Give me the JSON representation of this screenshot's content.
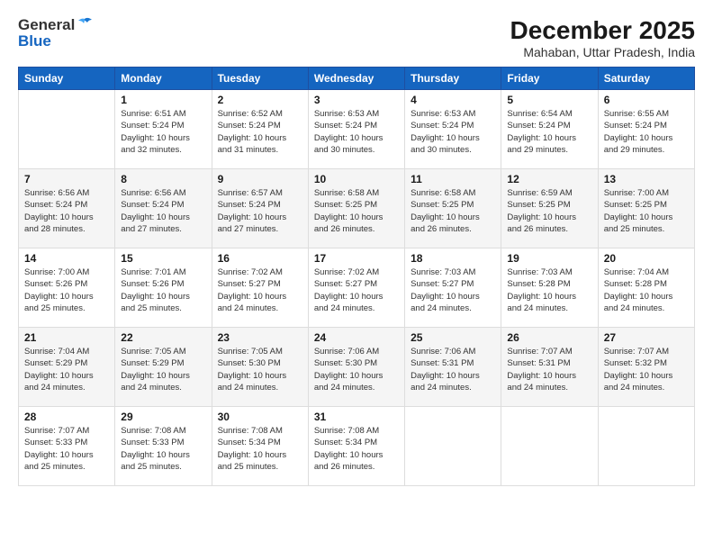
{
  "header": {
    "logo_general": "General",
    "logo_blue": "Blue",
    "title": "December 2025",
    "subtitle": "Mahaban, Uttar Pradesh, India"
  },
  "days_of_week": [
    "Sunday",
    "Monday",
    "Tuesday",
    "Wednesday",
    "Thursday",
    "Friday",
    "Saturday"
  ],
  "weeks": [
    {
      "gray": false,
      "cells": [
        {
          "day": "",
          "info": ""
        },
        {
          "day": "1",
          "info": "Sunrise: 6:51 AM\nSunset: 5:24 PM\nDaylight: 10 hours\nand 32 minutes."
        },
        {
          "day": "2",
          "info": "Sunrise: 6:52 AM\nSunset: 5:24 PM\nDaylight: 10 hours\nand 31 minutes."
        },
        {
          "day": "3",
          "info": "Sunrise: 6:53 AM\nSunset: 5:24 PM\nDaylight: 10 hours\nand 30 minutes."
        },
        {
          "day": "4",
          "info": "Sunrise: 6:53 AM\nSunset: 5:24 PM\nDaylight: 10 hours\nand 30 minutes."
        },
        {
          "day": "5",
          "info": "Sunrise: 6:54 AM\nSunset: 5:24 PM\nDaylight: 10 hours\nand 29 minutes."
        },
        {
          "day": "6",
          "info": "Sunrise: 6:55 AM\nSunset: 5:24 PM\nDaylight: 10 hours\nand 29 minutes."
        }
      ]
    },
    {
      "gray": true,
      "cells": [
        {
          "day": "7",
          "info": "Sunrise: 6:56 AM\nSunset: 5:24 PM\nDaylight: 10 hours\nand 28 minutes."
        },
        {
          "day": "8",
          "info": "Sunrise: 6:56 AM\nSunset: 5:24 PM\nDaylight: 10 hours\nand 27 minutes."
        },
        {
          "day": "9",
          "info": "Sunrise: 6:57 AM\nSunset: 5:24 PM\nDaylight: 10 hours\nand 27 minutes."
        },
        {
          "day": "10",
          "info": "Sunrise: 6:58 AM\nSunset: 5:25 PM\nDaylight: 10 hours\nand 26 minutes."
        },
        {
          "day": "11",
          "info": "Sunrise: 6:58 AM\nSunset: 5:25 PM\nDaylight: 10 hours\nand 26 minutes."
        },
        {
          "day": "12",
          "info": "Sunrise: 6:59 AM\nSunset: 5:25 PM\nDaylight: 10 hours\nand 26 minutes."
        },
        {
          "day": "13",
          "info": "Sunrise: 7:00 AM\nSunset: 5:25 PM\nDaylight: 10 hours\nand 25 minutes."
        }
      ]
    },
    {
      "gray": false,
      "cells": [
        {
          "day": "14",
          "info": "Sunrise: 7:00 AM\nSunset: 5:26 PM\nDaylight: 10 hours\nand 25 minutes."
        },
        {
          "day": "15",
          "info": "Sunrise: 7:01 AM\nSunset: 5:26 PM\nDaylight: 10 hours\nand 25 minutes."
        },
        {
          "day": "16",
          "info": "Sunrise: 7:02 AM\nSunset: 5:27 PM\nDaylight: 10 hours\nand 24 minutes."
        },
        {
          "day": "17",
          "info": "Sunrise: 7:02 AM\nSunset: 5:27 PM\nDaylight: 10 hours\nand 24 minutes."
        },
        {
          "day": "18",
          "info": "Sunrise: 7:03 AM\nSunset: 5:27 PM\nDaylight: 10 hours\nand 24 minutes."
        },
        {
          "day": "19",
          "info": "Sunrise: 7:03 AM\nSunset: 5:28 PM\nDaylight: 10 hours\nand 24 minutes."
        },
        {
          "day": "20",
          "info": "Sunrise: 7:04 AM\nSunset: 5:28 PM\nDaylight: 10 hours\nand 24 minutes."
        }
      ]
    },
    {
      "gray": true,
      "cells": [
        {
          "day": "21",
          "info": "Sunrise: 7:04 AM\nSunset: 5:29 PM\nDaylight: 10 hours\nand 24 minutes."
        },
        {
          "day": "22",
          "info": "Sunrise: 7:05 AM\nSunset: 5:29 PM\nDaylight: 10 hours\nand 24 minutes."
        },
        {
          "day": "23",
          "info": "Sunrise: 7:05 AM\nSunset: 5:30 PM\nDaylight: 10 hours\nand 24 minutes."
        },
        {
          "day": "24",
          "info": "Sunrise: 7:06 AM\nSunset: 5:30 PM\nDaylight: 10 hours\nand 24 minutes."
        },
        {
          "day": "25",
          "info": "Sunrise: 7:06 AM\nSunset: 5:31 PM\nDaylight: 10 hours\nand 24 minutes."
        },
        {
          "day": "26",
          "info": "Sunrise: 7:07 AM\nSunset: 5:31 PM\nDaylight: 10 hours\nand 24 minutes."
        },
        {
          "day": "27",
          "info": "Sunrise: 7:07 AM\nSunset: 5:32 PM\nDaylight: 10 hours\nand 24 minutes."
        }
      ]
    },
    {
      "gray": false,
      "cells": [
        {
          "day": "28",
          "info": "Sunrise: 7:07 AM\nSunset: 5:33 PM\nDaylight: 10 hours\nand 25 minutes."
        },
        {
          "day": "29",
          "info": "Sunrise: 7:08 AM\nSunset: 5:33 PM\nDaylight: 10 hours\nand 25 minutes."
        },
        {
          "day": "30",
          "info": "Sunrise: 7:08 AM\nSunset: 5:34 PM\nDaylight: 10 hours\nand 25 minutes."
        },
        {
          "day": "31",
          "info": "Sunrise: 7:08 AM\nSunset: 5:34 PM\nDaylight: 10 hours\nand 26 minutes."
        },
        {
          "day": "",
          "info": ""
        },
        {
          "day": "",
          "info": ""
        },
        {
          "day": "",
          "info": ""
        }
      ]
    }
  ]
}
